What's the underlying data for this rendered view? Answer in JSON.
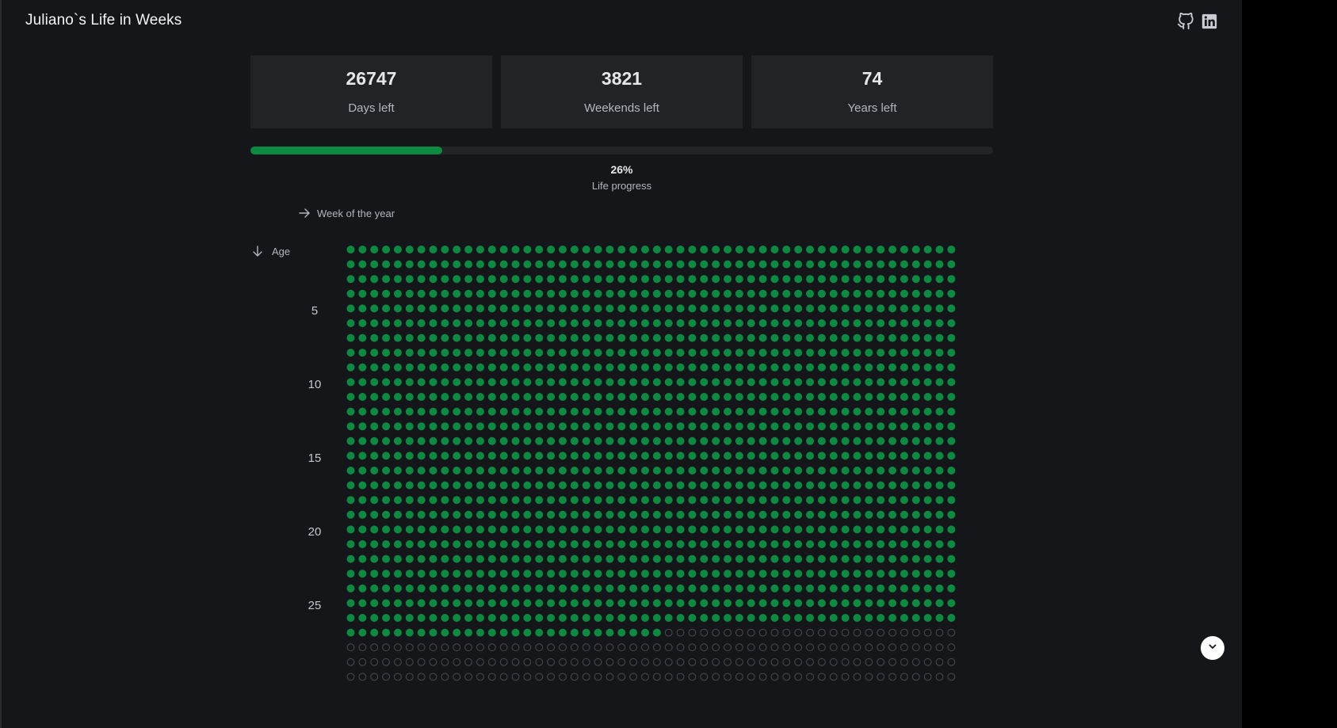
{
  "header": {
    "title": "Juliano`s Life in Weeks",
    "icons": [
      "github-icon",
      "linkedin-icon"
    ]
  },
  "stats": [
    {
      "value": "26747",
      "label": "Days left"
    },
    {
      "value": "3821",
      "label": "Weekends left"
    },
    {
      "value": "74",
      "label": "Years left"
    }
  ],
  "progress": {
    "percent_text": "26%",
    "label": "Life progress",
    "fraction": 0.26
  },
  "grid": {
    "week_axis_label": "Week of the year",
    "age_axis_label": "Age",
    "age_ticks": [
      "5",
      "10",
      "15",
      "20",
      "25"
    ],
    "weeks_per_year": 52,
    "visible_rows": 30,
    "filled_full_years": 26,
    "filled_weeks_current_year": 27,
    "colors": {
      "lived": "#0c8a41",
      "remaining_stroke": "#4a4c52",
      "background": "#151619"
    }
  },
  "scroll_button": {
    "icon": "chevron-down-icon"
  }
}
